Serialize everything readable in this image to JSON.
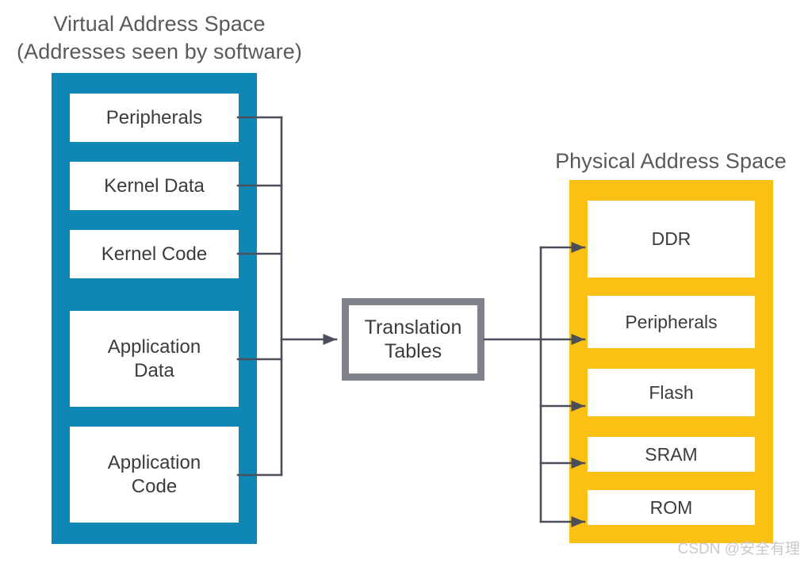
{
  "diagram": {
    "type": "block-diagram",
    "watermark": "CSDN @安全有理",
    "colors": {
      "virtual_space": "#0f87b4",
      "physical_space": "#fac013",
      "translation_box_border": "#808289",
      "connector_line": "#4a4f5a",
      "text": "#3c3c40",
      "title_text": "#58595b",
      "background": "#ffffff"
    },
    "virtual": {
      "title_line1": "Virtual Address Space",
      "title_line2": "(Addresses seen by software)",
      "title": "Virtual Address Space\n(Addresses seen by software)",
      "regions": [
        {
          "label": "Peripherals"
        },
        {
          "label": "Kernel Data"
        },
        {
          "label": "Kernel Code"
        },
        {
          "label": "Application\nData"
        },
        {
          "label": "Application\nCode"
        }
      ]
    },
    "translation": {
      "label": "Translation\nTables"
    },
    "physical": {
      "title": "Physical Address Space",
      "regions": [
        {
          "label": "DDR"
        },
        {
          "label": "Peripherals"
        },
        {
          "label": "Flash"
        },
        {
          "label": "SRAM"
        },
        {
          "label": "ROM"
        }
      ]
    }
  }
}
